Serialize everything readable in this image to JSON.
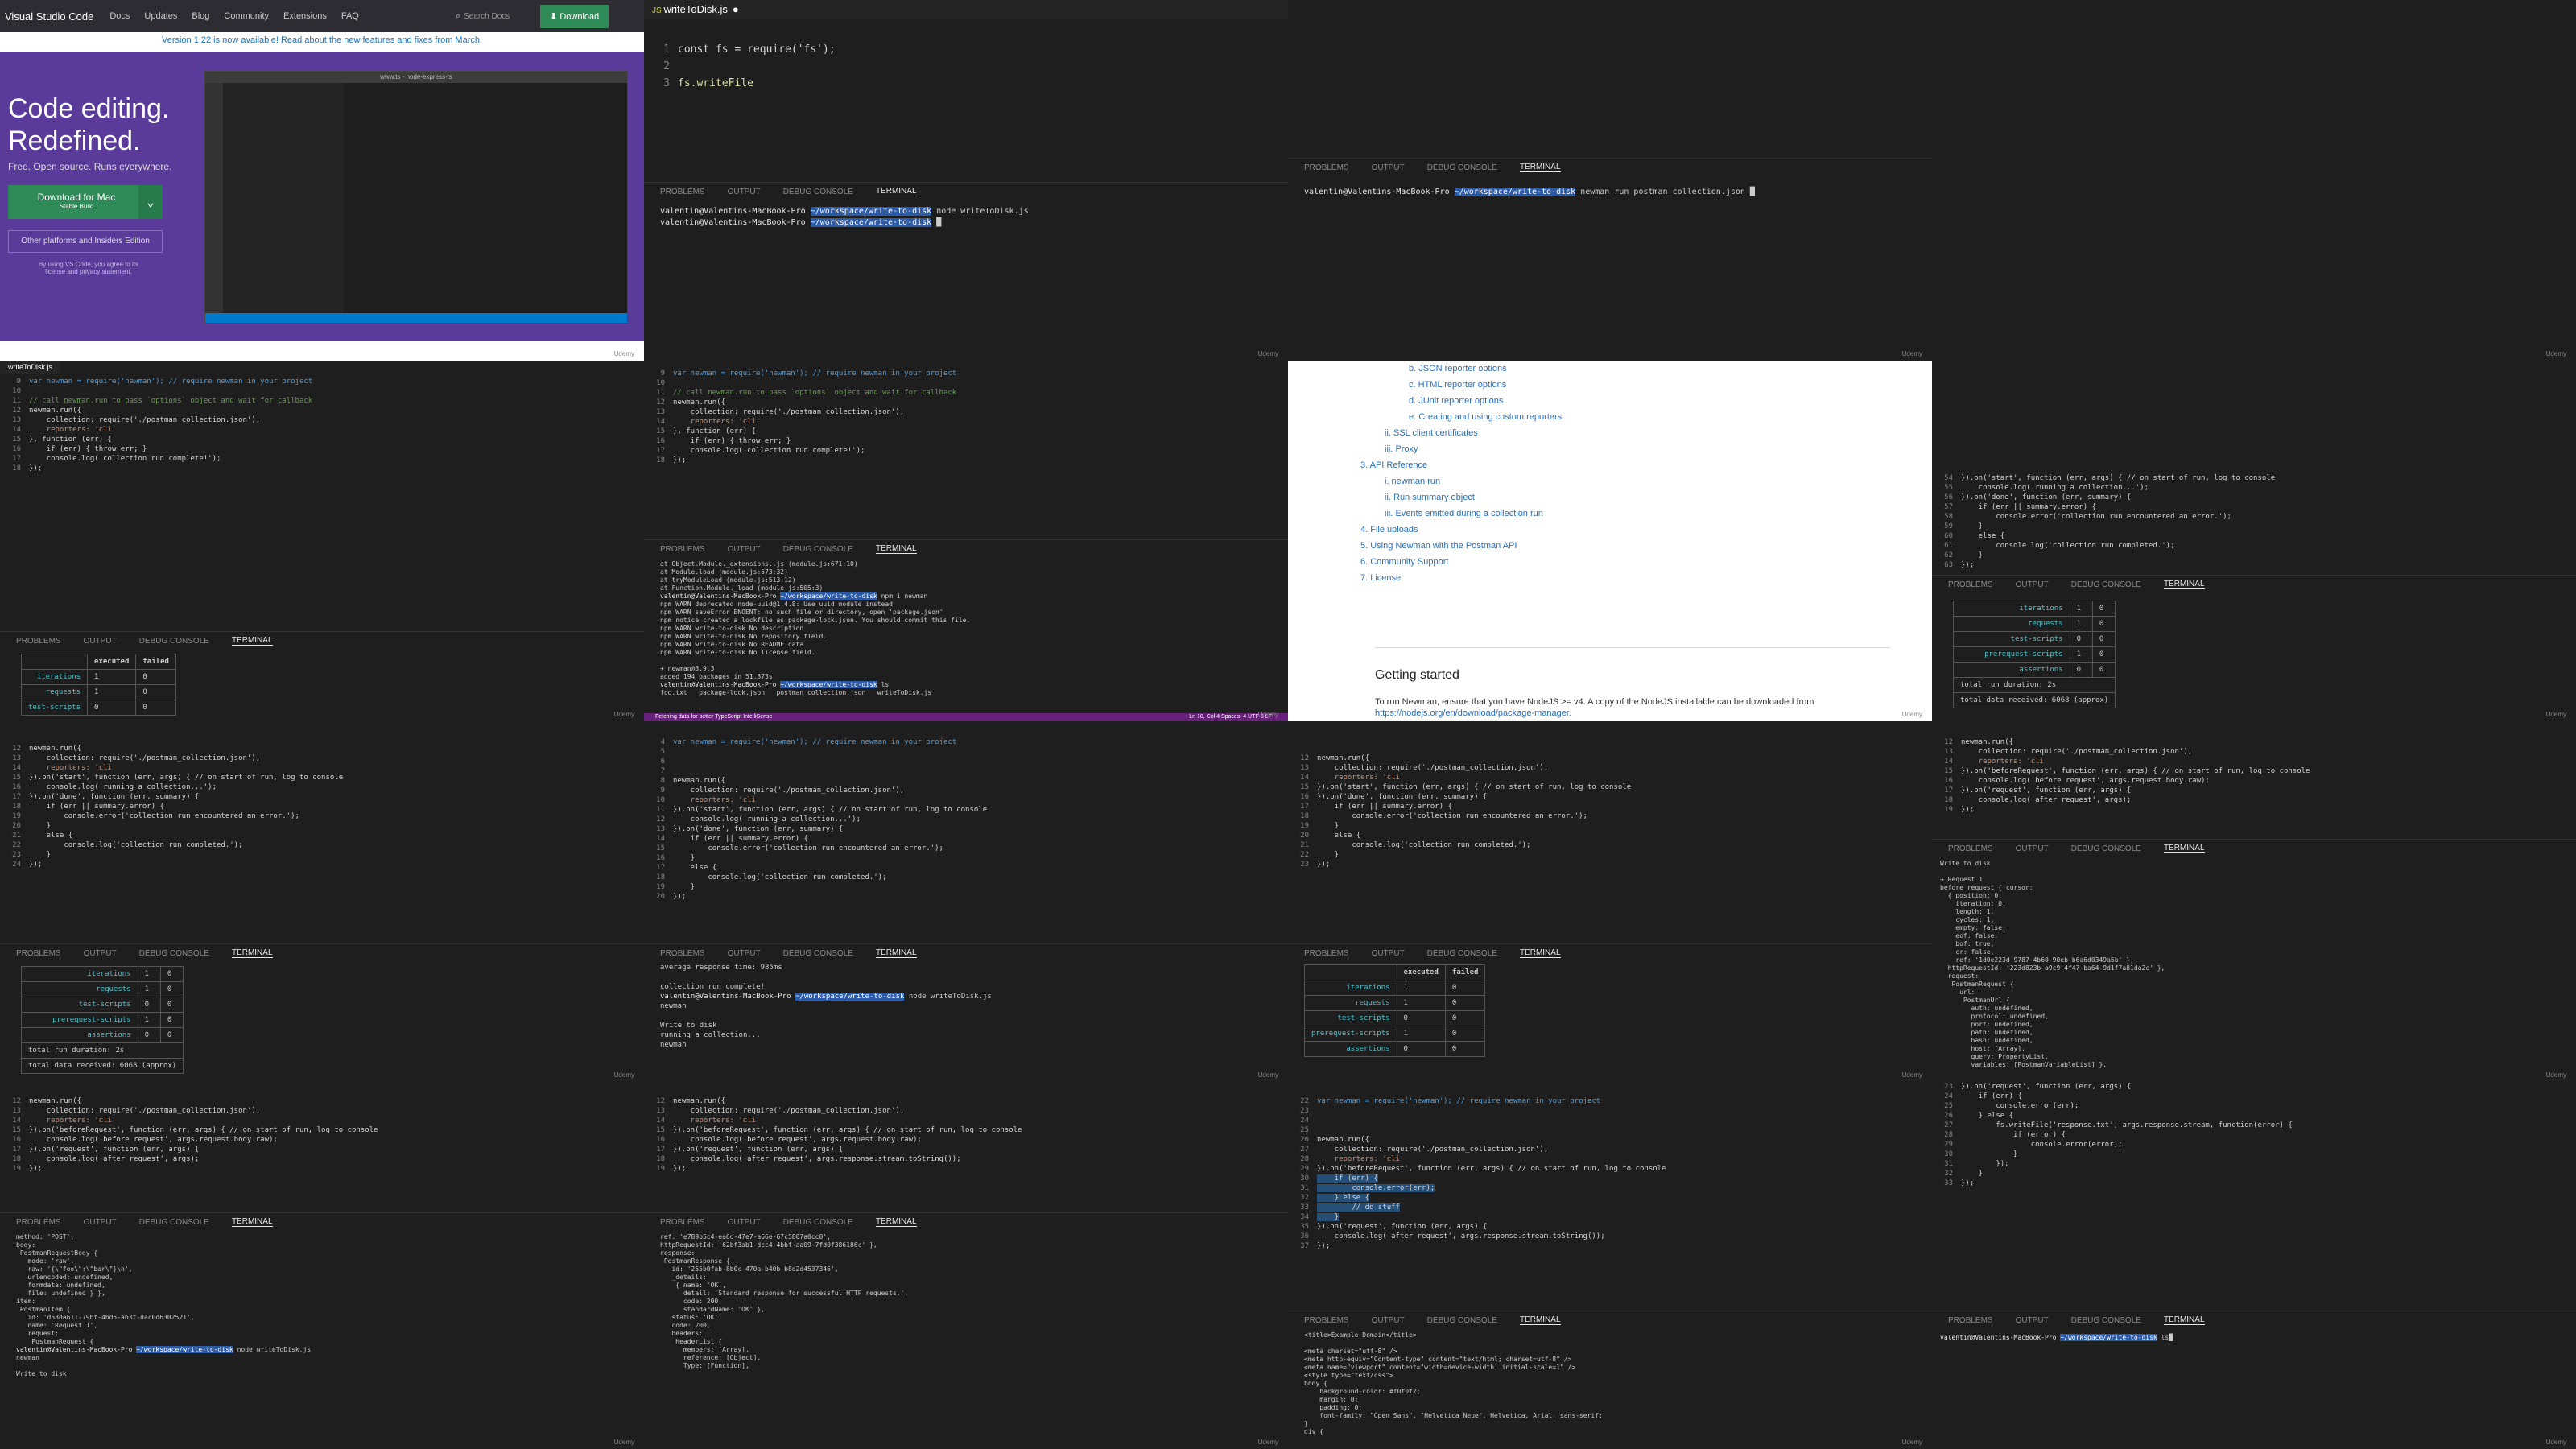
{
  "vscode_site": {
    "brand": "Visual Studio Code",
    "nav": [
      "Docs",
      "Updates",
      "Blog",
      "Community",
      "Extensions",
      "FAQ"
    ],
    "search_placeholder": "Search Docs",
    "download_button": "Download",
    "banner": "Version 1.22 is now available! Read about the new features and fixes from March.",
    "headline_1": "Code editing.",
    "headline_2": "Redefined.",
    "tagline": "Free. Open source. Runs everywhere.",
    "mac_button": "Download for Mac",
    "mac_sub": "Stable Build",
    "other_platforms": "Other platforms and Insiders Edition",
    "legal": "By using VS Code, you agree to its license and privacy statement.",
    "screenshot_title": "www.ts - node-express-ts"
  },
  "editor_top": {
    "filename": "writeToDisk.js",
    "lines": [
      "const fs = require('fs');",
      "",
      "fs.writeFile"
    ]
  },
  "panel_tabs": [
    "PROBLEMS",
    "OUTPUT",
    "DEBUG CONSOLE",
    "TERMINAL"
  ],
  "term_user": "valentin@Valentins-MacBook-Pro",
  "term_path": "~/workspace/write-to-disk",
  "term_cmd_node": "node writeToDisk.js",
  "term_cmd_newman": "newman run postman_collection.json",
  "term_cmd_ls": "ls",
  "docs": {
    "items": [
      "b. JSON reporter options",
      "c. HTML reporter options",
      "d. JUnit reporter options",
      "e. Creating and using custom reporters",
      "ii. SSL client certificates",
      "iii. Proxy",
      "3. API Reference",
      "i. newman run",
      "ii. Run summary object",
      "iii. Events emitted during a collection run",
      "4. File uploads",
      "5. Using Newman with the Postman API",
      "6. Community Support",
      "7. License"
    ],
    "heading": "Getting started",
    "body": "To run Newman, ensure that you have NodeJS >= v4. A copy of the NodeJS installable can be downloaded from",
    "link": "https://nodejs.org/en/download/package-manager."
  },
  "run_table": {
    "headers": [
      "",
      "executed",
      "failed"
    ],
    "rows": [
      [
        "iterations",
        "1",
        "0"
      ],
      [
        "requests",
        "1",
        "0"
      ],
      [
        "test-scripts",
        "0",
        "0"
      ],
      [
        "prerequest-scripts",
        "1",
        "0"
      ],
      [
        "assertions",
        "0",
        "0"
      ]
    ],
    "duration": "total run duration: 2s",
    "received": "total data received: 6068 (approx)"
  },
  "statusbar": {
    "left": "Fetching data for better TypeScript IntelliSense",
    "right": "Ln 18, Col 4   Spaces: 4   UTF-8   LF"
  },
  "watermark": "Udemy",
  "code_newman": [
    "var newman = require('newman'); // require newman in your project",
    "",
    "// call newman.run to pass `options` object and wait for callback",
    "newman.run({",
    "    collection: require('./postman_collection.json'),",
    "    reporters: 'cli'",
    "}, function (err) {",
    "    if (err) { throw err; }",
    "    console.log('collection run complete!');",
    "});"
  ],
  "code_events": [
    "newman.run({",
    "    collection: require('./postman_collection.json'),",
    "    reporters: 'cli'",
    "}).on('start', function (err, args) { // on start of run, log to console",
    "    console.log('running a collection...');",
    "}).on('done', function (err, summary) {",
    "    if (err || summary.error) {",
    "        console.error('collection run encountered an error.');",
    "    }",
    "    else {",
    "        console.log('collection run completed.');",
    "    }",
    "});"
  ],
  "code_request": [
    "newman.run({",
    "    collection: require('./postman_collection.json'),",
    "    reporters: 'cli'",
    "}).on('beforeRequest', function (err, args) { // on start of run, log to console",
    "    console.log('before request', args.request.body.raw);",
    "}).on('request', function (err, args) {",
    "    console.log('after request', args);",
    "});"
  ],
  "npm_log": [
    "at Object.Module._extensions..js (module.js:671:10)",
    "at Module.load (module.js:573:32)",
    "at tryModuleLoad (module.js:513:12)",
    "at Function.Module._load (module.js:505:3)",
    "npm i newman",
    "npm WARN deprecated node-uuid@1.4.8: Use uuid module instead",
    "npm WARN saveError ENOENT: no such file or directory, open 'package.json'",
    "npm notice created a lockfile as package-lock.json. You should commit this file.",
    "npm WARN write-to-disk No description",
    "npm WARN write-to-disk No repository field.",
    "npm WARN write-to-disk No README data",
    "npm WARN write-to-disk No license field.",
    "+ newman@3.9.3",
    "added 194 packages in 51.873s",
    "foo.txt   package-lock.json   postman_collection.json   writeToDisk.js"
  ],
  "output_write": [
    "average response time: 985ms",
    "",
    "collection run complete!",
    "node writeToDisk.js",
    "newman",
    "",
    "Write to disk",
    "running a collection...",
    "newman",
    "",
    "Write to disk",
    "",
    "→ Request 1",
    "",
    "→ Request 1"
  ],
  "output_request_obj": [
    "Write to disk",
    "",
    "→ Request 1",
    "before request { cursor:",
    "  { position: 0,",
    "    iteration: 0,",
    "    length: 1,",
    "    cycles: 1,",
    "    empty: false,",
    "    eof: false,",
    "    bof: true,",
    "    cr: false,",
    "    ref: '1d0e223d-9787-4b60-90eb-b6a6d0349a5b' },",
    "  httpRequestId: '223d823b-a9c9-4f47-ba64-9d1f7a81da2c' },",
    "  request:",
    "   PostmanRequest {",
    "     url:",
    "      PostmanUrl {",
    "        auth: undefined,",
    "        protocol: undefined,",
    "        port: undefined,",
    "        path: undefined,",
    "        hash: undefined,",
    "        host: [Array],",
    "        query: PropertyList,",
    "        variables: [PostmanVariableList] },"
  ],
  "output_body": [
    "method: 'POST',",
    "body:",
    " PostmanRequestBody {",
    "   mode: 'raw',",
    "   raw: '{\\\"foo\\\":\\\"bar\\\"}\\n',",
    "   urlencoded: undefined,",
    "   formdata: undefined,",
    "   file: undefined } },",
    "item:",
    " PostmanItem {",
    "   id: 'd58da611-79bf-4bd5-ab3f-dac0d6302521',",
    "   name: 'Request 1',",
    "   request:",
    "    PostmanRequest {"
  ],
  "output_response": [
    "ref: 'e789b5c4-ea6d-47e7-a66e-67c5807a0cc0',",
    "httpRequestId: '62bf3ab1-dcc4-4bbf-aa09-7fd0f386186c' },",
    "response:",
    " PostmanResponse {",
    "   id: '255b0fab-8b0c-470a-b40b-b8d2d4537346',",
    "   _details:",
    "    { name: 'OK',",
    "      detail: 'Standard response for successful HTTP requests.',",
    "      code: 200,",
    "      standardName: 'OK' },",
    "   status: 'OK',",
    "   code: 200,",
    "   headers:",
    "    HeaderList {",
    "      members: [Array],",
    "      reference: [Object],",
    "      Type: [Function],"
  ],
  "output_html": [
    "<title>Example Domain</title>",
    "",
    "<meta charset=\"utf-8\" />",
    "<meta http-equiv=\"Content-type\" content=\"text/html; charset=utf-8\" />",
    "<meta name=\"viewport\" content=\"width=device-width, initial-scale=1\" />",
    "<style type=\"text/css\">",
    "body {",
    "    background-color: #f0f0f2;",
    "    margin: 0;",
    "    padding: 0;",
    "    font-family: \"Open Sans\", \"Helvetica Neue\", Helvetica, Arial, sans-serif;",
    "}",
    "div {"
  ],
  "code_writefile": [
    "newman.run({",
    "    collection: require('./postman_collection.json'),",
    "    reporters: 'cli'",
    "}).on('beforeRequest', function (err, args) { // on start of run, log to console",
    "    if (err) {",
    "        console.error(err);",
    "    } else {",
    "        // do stuff",
    "    }",
    "}).on('request', function (err, args) {",
    "    console.log('after request', args.response.stream.toString());",
    "});"
  ],
  "code_fswrite": [
    "}).on('request', function (err, args) {",
    "    if (err) {",
    "        console.error(err);",
    "    } else {",
    "        fs.writeFile('response.txt', args.response.stream, function(error) {",
    "            if (error) {",
    "                console.error(error);",
    "            }",
    "        });",
    "    }",
    "});"
  ]
}
